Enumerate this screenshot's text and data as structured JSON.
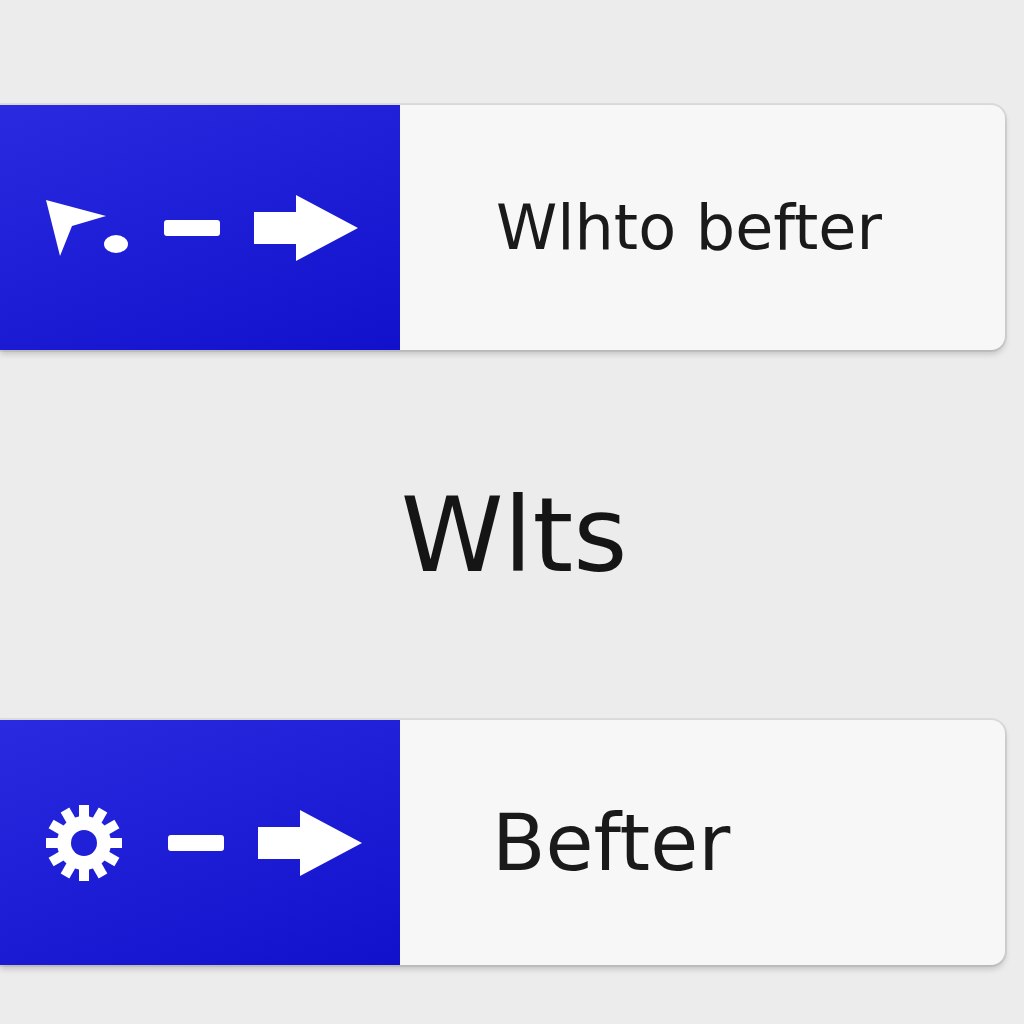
{
  "bars": [
    {
      "kind": "pointer",
      "label": "Wlhto befter"
    },
    {
      "kind": "gear",
      "label": "Befter"
    }
  ],
  "heading": "Wlts"
}
